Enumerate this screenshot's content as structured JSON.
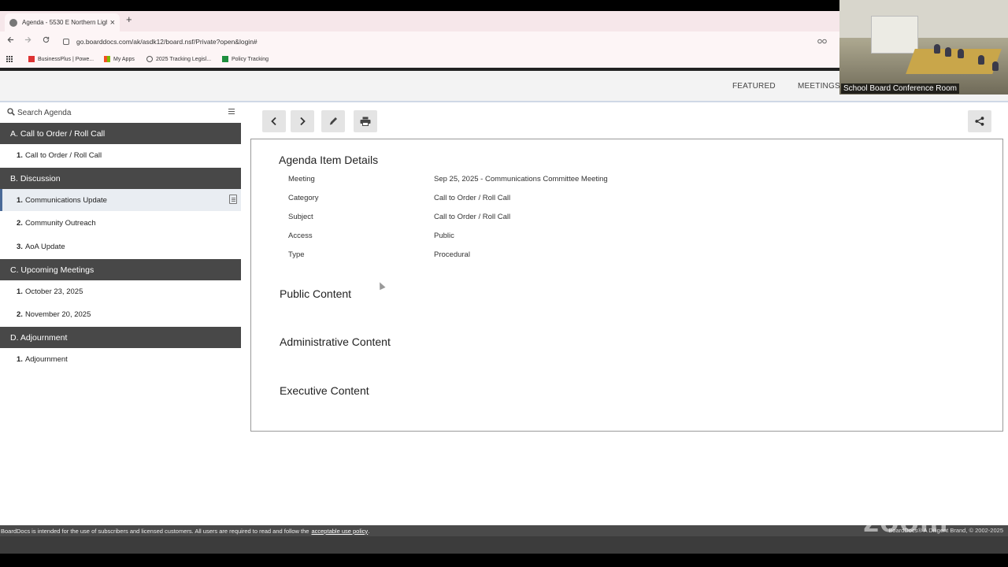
{
  "browser": {
    "tab_title": "Agenda - 5530 E Northern Ligh",
    "new_tab": "+",
    "close": "×",
    "url": "go.boarddocs.com/ak/asdk12/board.nsf/Private?open&login#",
    "bookmarks": [
      {
        "label": "BusinessPlus | Powe...",
        "color": "#d33"
      },
      {
        "label": "My Apps",
        "color": "#f25022"
      },
      {
        "label": "2025 Tracking Legisl...",
        "color": "#555"
      },
      {
        "label": "Policy Tracking",
        "color": "#1e8e3e"
      }
    ]
  },
  "header": {
    "featured": "FEATURED",
    "meetings": "MEETINGS"
  },
  "video": {
    "label": "School Board Conference Room"
  },
  "sidebar": {
    "search_placeholder": "Search Agenda",
    "categories": [
      {
        "label": "A. Call to Order / Roll Call",
        "items": [
          {
            "num": "1.",
            "label": "Call to Order / Roll Call"
          }
        ]
      },
      {
        "label": "B. Discussion",
        "items": [
          {
            "num": "1.",
            "label": "Communications Update"
          },
          {
            "num": "2.",
            "label": "Community Outreach"
          },
          {
            "num": "3.",
            "label": "AoA Update"
          }
        ]
      },
      {
        "label": "C. Upcoming Meetings",
        "items": [
          {
            "num": "1.",
            "label": "October 23, 2025"
          },
          {
            "num": "2.",
            "label": "November 20, 2025"
          }
        ]
      },
      {
        "label": "D. Adjournment",
        "items": [
          {
            "num": "1.",
            "label": "Adjournment"
          }
        ]
      }
    ]
  },
  "details": {
    "heading": "Agenda Item Details",
    "rows": [
      {
        "label": "Meeting",
        "value": "Sep 25, 2025 - Communications Committee Meeting"
      },
      {
        "label": "Category",
        "value": "Call to Order / Roll Call"
      },
      {
        "label": "Subject",
        "value": "Call to Order / Roll Call"
      },
      {
        "label": "Access",
        "value": "Public"
      },
      {
        "label": "Type",
        "value": "Procedural"
      }
    ],
    "public_content": "Public Content",
    "administrative_content": "Administrative Content",
    "executive_content": "Executive Content"
  },
  "footer": {
    "text": "BoardDocs is intended for the use of subscribers and licensed customers. All users are required to read and follow the",
    "link": "acceptable use policy",
    "period": ".",
    "right": "BoardDocs® A Diligent Brand, © 2002-2025"
  },
  "watermark": "zoom"
}
